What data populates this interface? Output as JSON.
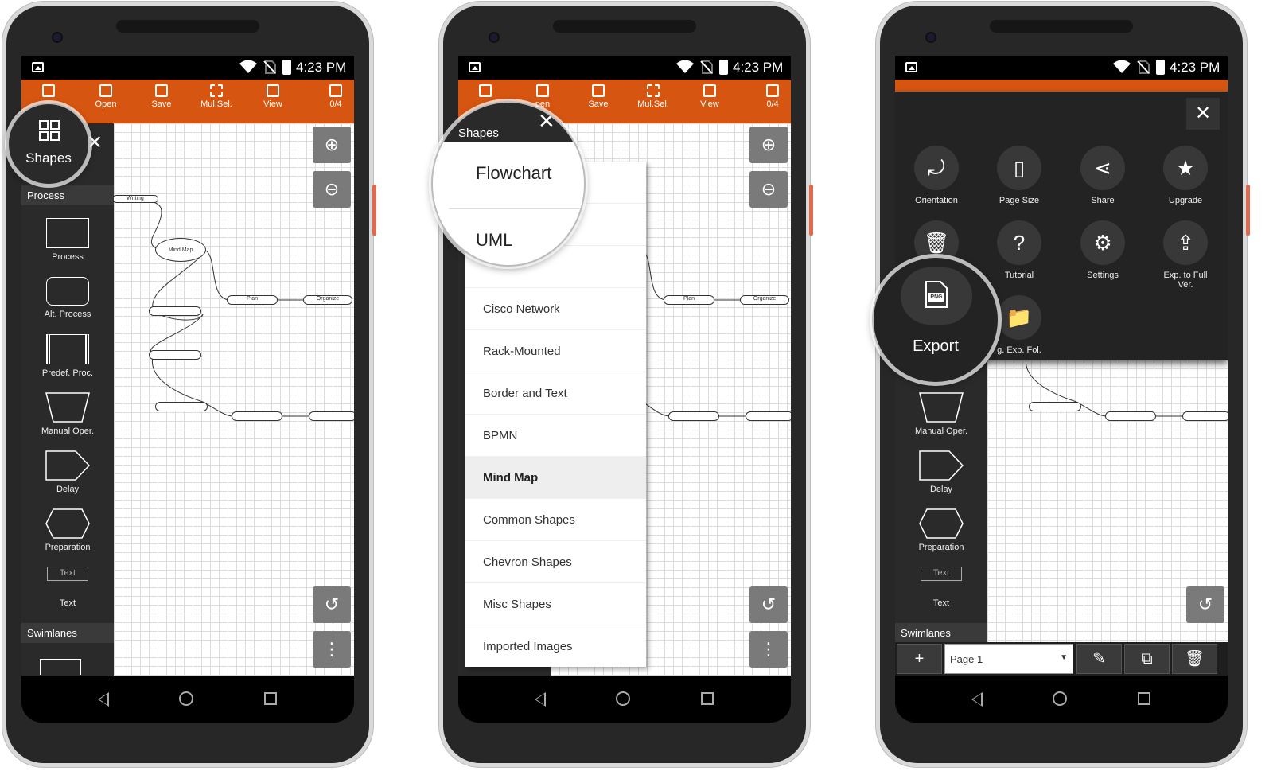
{
  "status": {
    "time": "4:23 PM"
  },
  "toolbar": {
    "items": [
      {
        "label": "",
        "icon": "new-file-icon"
      },
      {
        "label": "Open",
        "icon": "open-icon"
      },
      {
        "label": "Save",
        "icon": "save-icon"
      },
      {
        "label": "Mul.Sel.",
        "icon": "multi-select-icon"
      },
      {
        "label": "View",
        "icon": "view-icon"
      },
      {
        "label": "0/4",
        "icon": "save-icon"
      }
    ],
    "color": "#d65511"
  },
  "screen1": {
    "shapes_label": "Shapes",
    "sections": [
      "Process",
      "Swimlanes"
    ],
    "shapes": [
      "Process",
      "Alt. Process",
      "Predef. Proc.",
      "Manual Oper.",
      "Delay",
      "Preparation",
      "Text"
    ],
    "text_shape_label": "Text",
    "nodes": [
      "Writing",
      "Mind Map",
      "Plan",
      "Organize"
    ]
  },
  "screen2": {
    "shapes_label": "Shapes",
    "toolbar_partial_open": "pen",
    "magnified": [
      "Flowchart",
      "UML"
    ],
    "categories": [
      "Cisco Network",
      "Rack-Mounted",
      "Border and Text",
      "BPMN",
      "Mind Map",
      "Common Shapes",
      "Chevron Shapes",
      "Misc Shapes",
      "Imported Images"
    ],
    "selected": "Mind Map",
    "nodes": [
      "Plan",
      "Organize"
    ]
  },
  "screen3": {
    "menu": [
      {
        "label": "Orientation",
        "icon": "orientation-icon"
      },
      {
        "label": "Page Size",
        "icon": "page-size-icon"
      },
      {
        "label": "Share",
        "icon": "share-icon"
      },
      {
        "label": "Upgrade",
        "icon": "star-icon"
      },
      {
        "label": "D",
        "icon": "trash-icon"
      },
      {
        "label": "Tutorial",
        "icon": "question-icon"
      },
      {
        "label": "Settings",
        "icon": "gear-icon"
      },
      {
        "label": "Exp. to Full Ver.",
        "icon": "export-up-icon"
      },
      {
        "label": "g. Exp. Fol.",
        "icon": "folder-gear-icon"
      }
    ],
    "export_label": "Export",
    "export_icon_text": "PNG",
    "shapes": [
      "Manual Oper.",
      "Delay",
      "Preparation",
      "Text"
    ],
    "text_shape_label": "Text",
    "swimlanes": "Swimlanes",
    "page_select": "Page 1"
  }
}
